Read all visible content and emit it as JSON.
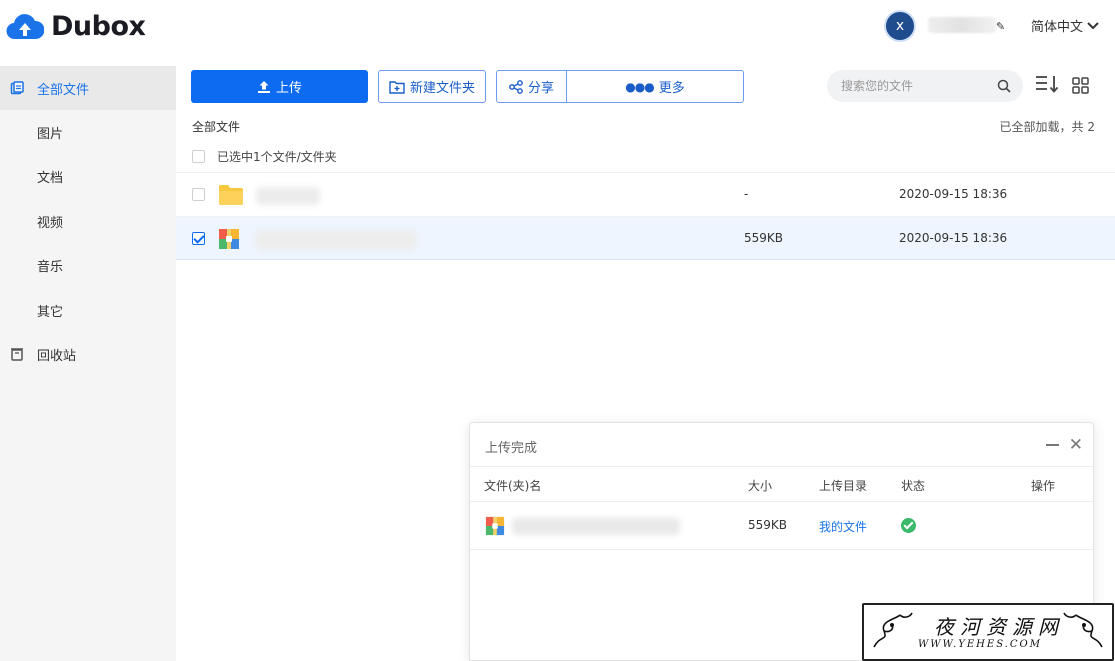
{
  "app": {
    "name": "Dubox"
  },
  "header": {
    "avatar_letter": "x",
    "language": "简体中文"
  },
  "sidebar": {
    "items": [
      {
        "label": "全部文件",
        "icon": "files-icon",
        "active": true
      },
      {
        "label": "图片"
      },
      {
        "label": "文档"
      },
      {
        "label": "视频"
      },
      {
        "label": "音乐"
      },
      {
        "label": "其它"
      },
      {
        "label": "回收站",
        "icon": "trash-icon"
      }
    ]
  },
  "toolbar": {
    "upload_label": "上传",
    "new_folder_label": "新建文件夹",
    "share_label": "分享",
    "more_label": "更多",
    "search_placeholder": "搜索您的文件"
  },
  "list": {
    "breadcrumb": "全部文件",
    "loaded_text": "已全部加载，共 2",
    "selection_text": "已选中1个文件/文件夹",
    "rows": [
      {
        "type": "folder",
        "size": "-",
        "date": "2020-09-15 18:36",
        "checked": false
      },
      {
        "type": "archive",
        "size": "559KB",
        "date": "2020-09-15 18:36",
        "checked": true
      }
    ]
  },
  "upload_panel": {
    "title": "上传完成",
    "columns": {
      "name": "文件(夹)名",
      "size": "大小",
      "dir": "上传目录",
      "status": "状态",
      "action": "操作"
    },
    "rows": [
      {
        "size": "559KB",
        "dir": "我的文件",
        "status": "success"
      }
    ]
  },
  "watermark": {
    "title": "夜河资源网",
    "url": "WWW.YEHES.COM"
  },
  "colors": {
    "primary": "#0d6bf2",
    "sidebar_bg": "#f5f5f6",
    "selected_row": "#eef5fe",
    "success": "#3bba6b"
  }
}
